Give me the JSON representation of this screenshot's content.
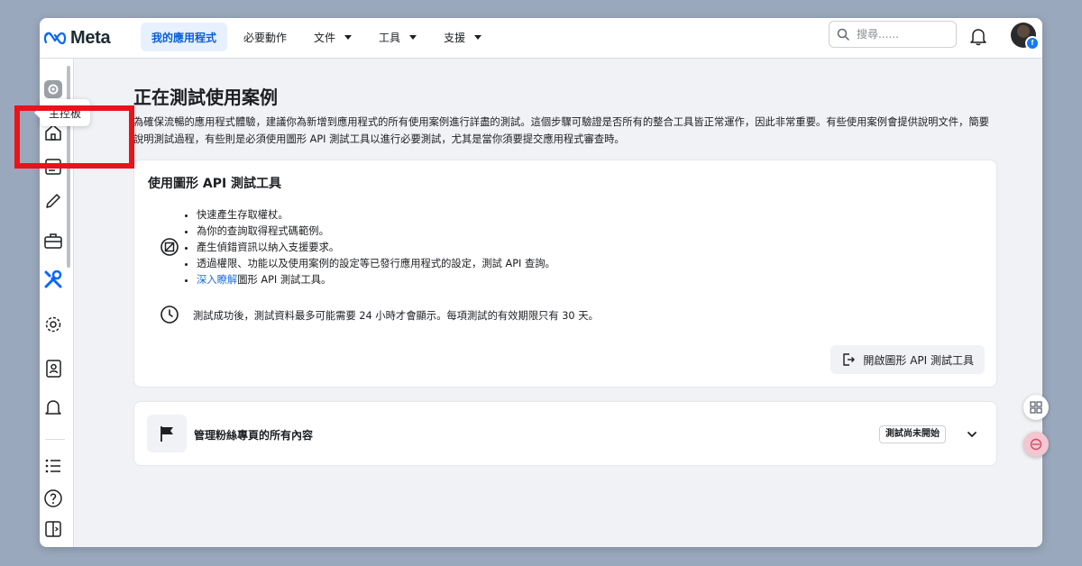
{
  "topbar": {
    "logo_text": "Meta",
    "nav": [
      {
        "label": "我的應用程式",
        "active": true
      },
      {
        "label": "必要動作"
      },
      {
        "label": "文件"
      },
      {
        "label": "工具"
      },
      {
        "label": "支援"
      }
    ],
    "search_placeholder": "搜尋......",
    "icons": [
      "meta-logo-icon",
      "search-icon",
      "bell-icon",
      "avatar"
    ]
  },
  "sidebar": {
    "icons": [
      "app-settings-icon",
      "home-icon",
      "dashboard-icon",
      "pencil-icon",
      "briefcase-icon",
      "tools-icon",
      "gear-icon",
      "contacts-icon",
      "bell-icon",
      "list-icon",
      "help-icon",
      "panel-toggle-icon"
    ],
    "active_icon": "tools-icon",
    "accent_color": "#0866ff"
  },
  "tooltip": {
    "label": "主控板"
  },
  "highlight_color": "#e8141b",
  "main": {
    "title": "正在測試使用案例",
    "description": "為確保流暢的應用程式體驗，建議你為新增到應用程式的所有使用案例進行詳盡的測試。這個步驟可驗證是否所有的整合工具皆正常運作，因此非常重要。有些使用案例會提供說明文件，簡要說明測試過程，有些則是必須使用圖形 API 測試工具以進行必要測試，尤其是當你須要提交應用程式審查時。",
    "graph_card": {
      "title": "使用圖形 API 測試工具",
      "bullets": [
        "快速產生存取權杖。",
        "為你的查詢取得程式碼範例。",
        "產生偵錯資訊以納入支援要求。",
        "透過權限、功能以及使用案例的設定等已發行應用程式的設定，測試 API 查詢。"
      ],
      "learn_more_link": "深入瞭解",
      "learn_more_rest": "圖形 API 測試工具。",
      "note": "測試成功後，測試資料最多可能需要 24 小時才會顯示。每項測試的有效期限只有 30 天。",
      "open_button": "開啟圖形 API 測試工具"
    },
    "usecase_card": {
      "title": "管理粉絲專頁的所有內容",
      "status": "測試尚未開始"
    }
  }
}
